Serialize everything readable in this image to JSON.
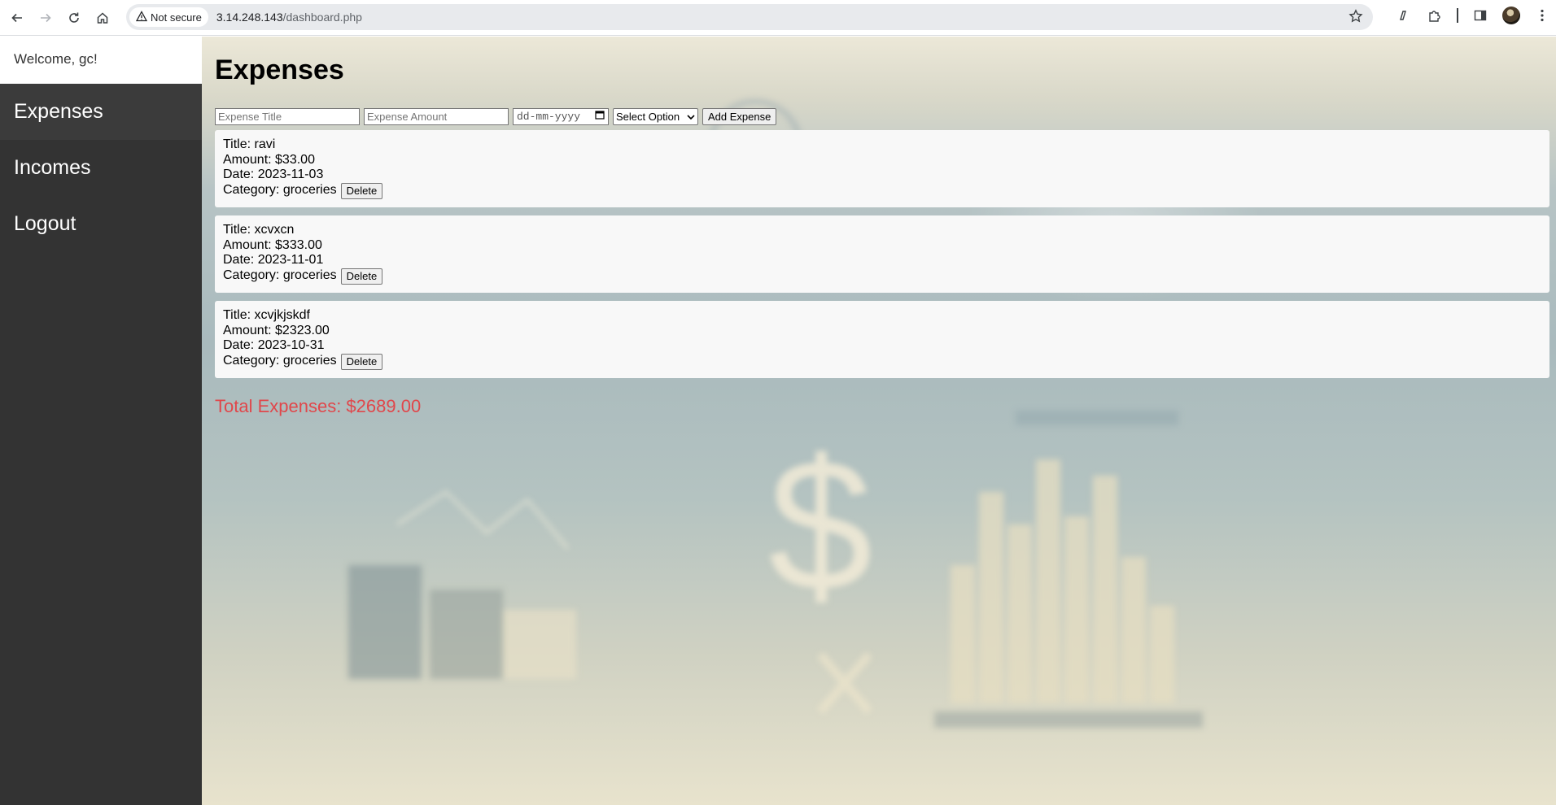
{
  "browser": {
    "security_label": "Not secure",
    "url_host": "3.14.248.143",
    "url_path": "/dashboard.php"
  },
  "sidebar": {
    "welcome": "Welcome, gc!",
    "items": [
      {
        "label": "Expenses",
        "active": true
      },
      {
        "label": "Incomes",
        "active": false
      },
      {
        "label": "Logout",
        "active": false
      }
    ]
  },
  "main": {
    "title": "Expenses",
    "form": {
      "title_placeholder": "Expense Title",
      "amount_placeholder": "Expense Amount",
      "date_placeholder": "dd-mm-yyyy",
      "category_selected": "Select Option",
      "add_label": "Add Expense"
    },
    "expenses": [
      {
        "title": "Title: ravi",
        "amount": "Amount: $33.00",
        "date": "Date: 2023-11-03",
        "category": "Category: groceries",
        "delete_label": "Delete"
      },
      {
        "title": "Title: xcvxcn",
        "amount": "Amount: $333.00",
        "date": "Date: 2023-11-01",
        "category": "Category: groceries",
        "delete_label": "Delete"
      },
      {
        "title": "Title: xcvjkjskdf",
        "amount": "Amount: $2323.00",
        "date": "Date: 2023-10-31",
        "category": "Category: groceries",
        "delete_label": "Delete"
      }
    ],
    "total": "Total Expenses: $2689.00"
  },
  "colors": {
    "sidebar_bg": "#333333",
    "total_text": "#e0474b",
    "card_bg": "#f8f8f8"
  },
  "icons": [
    "back-icon",
    "forward-icon",
    "reload-icon",
    "home-icon",
    "warning-icon",
    "star-icon",
    "extension-icon",
    "puzzle-icon",
    "side-panel-icon",
    "profile-avatar",
    "menu-icon"
  ]
}
